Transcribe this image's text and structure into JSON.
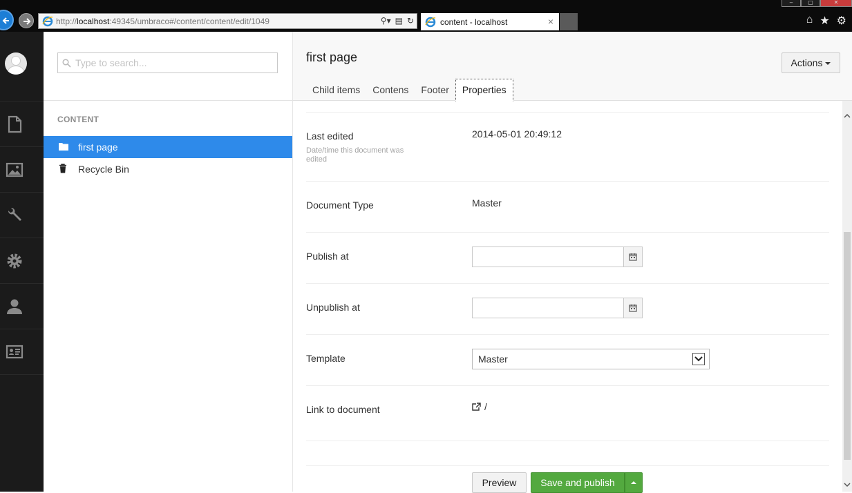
{
  "browser": {
    "url_scheme": "http://",
    "url_host": "localhost",
    "url_rest": ":49345/umbraco#/content/content/edit/1049",
    "tab_title": "content - localhost",
    "tab_close": "×"
  },
  "tree": {
    "search_placeholder": "Type to search...",
    "heading": "CONTENT",
    "items": [
      {
        "label": "first page",
        "icon": "folder-icon",
        "selected": true
      },
      {
        "label": "Recycle Bin",
        "icon": "trash-icon",
        "selected": false
      }
    ]
  },
  "header": {
    "title": "first page",
    "actions_label": "Actions",
    "tabs": [
      {
        "label": "Child items"
      },
      {
        "label": "Contens"
      },
      {
        "label": "Footer"
      },
      {
        "label": "Properties",
        "active": true
      }
    ]
  },
  "properties": {
    "last_edited": {
      "label": "Last edited",
      "description": "Date/time this document was edited",
      "value": "2014-05-01 20:49:12"
    },
    "document_type": {
      "label": "Document Type",
      "value": "Master"
    },
    "publish_at": {
      "label": "Publish at",
      "value": ""
    },
    "unpublish_at": {
      "label": "Unpublish at",
      "value": ""
    },
    "template": {
      "label": "Template",
      "value": "Master"
    },
    "link": {
      "label": "Link to document",
      "value": "/"
    }
  },
  "footer": {
    "preview_label": "Preview",
    "publish_label": "Save and publish"
  },
  "colors": {
    "selected_tree_item": "#2e8aea",
    "publish_button": "#53a93f",
    "sections_bar": "#1b1b1b"
  }
}
